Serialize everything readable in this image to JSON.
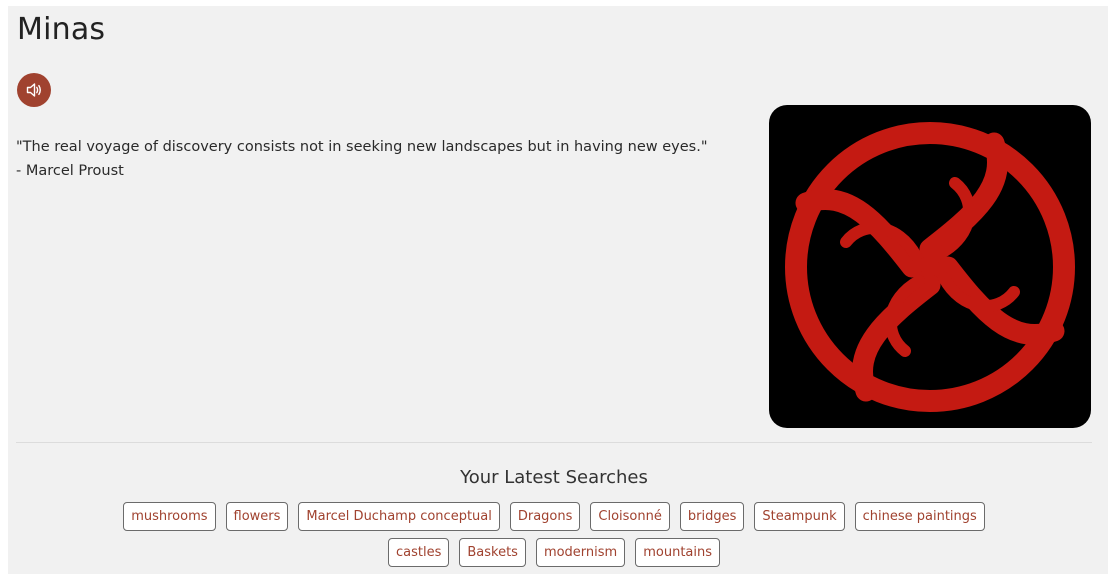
{
  "page": {
    "title": "Minas"
  },
  "quote": {
    "text": "\"The real voyage of discovery consists not in seeking new landscapes but in having new eyes.\"",
    "author": "- Marcel Proust"
  },
  "searches": {
    "heading": "Your Latest Searches",
    "row1": [
      "mushrooms",
      "flowers",
      "Marcel Duchamp conceptual",
      "Dragons",
      "Cloisonné",
      "bridges",
      "Steampunk",
      "chinese paintings"
    ],
    "row2": [
      "castles",
      "Baskets",
      "modernism",
      "mountains"
    ]
  },
  "colors": {
    "accent": "#a0422f",
    "logo_red": "#c41a12",
    "logo_bg": "#000000"
  },
  "icons": {
    "audio": "speaker-icon"
  }
}
